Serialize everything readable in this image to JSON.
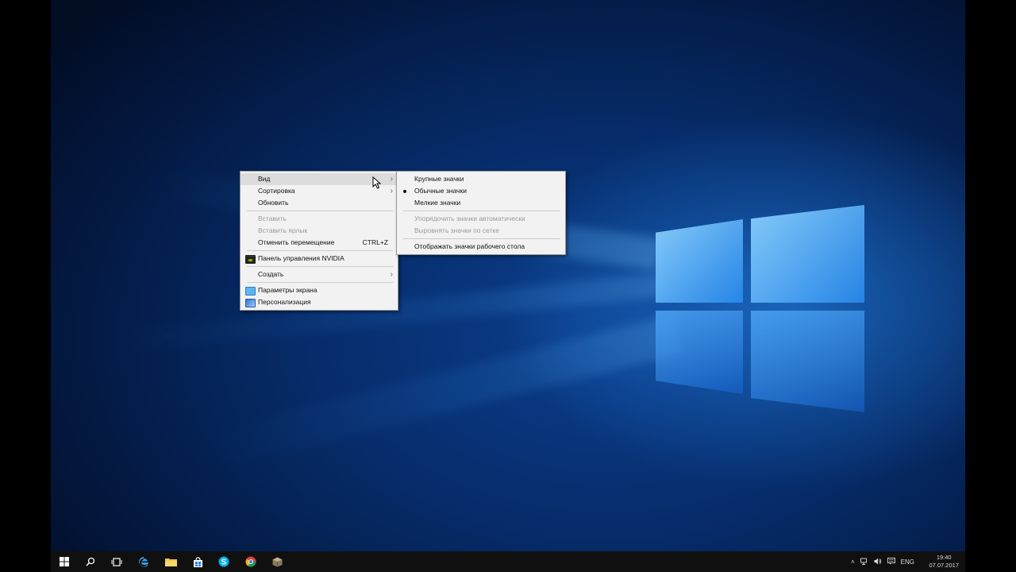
{
  "main_menu": {
    "items": [
      {
        "label": "Вид",
        "submenu": true
      },
      {
        "label": "Сортировка",
        "submenu": true
      },
      {
        "label": "Обновить"
      },
      {
        "label": "Вставить",
        "disabled": true
      },
      {
        "label": "Вставить ярлык",
        "disabled": true
      },
      {
        "label": "Отменить перемещение",
        "shortcut": "CTRL+Z"
      },
      {
        "label": "Панель управления NVIDIA",
        "icon": "nvidia-icon"
      },
      {
        "label": "Создать",
        "submenu": true
      },
      {
        "label": "Параметры экрана",
        "icon": "display-settings-icon"
      },
      {
        "label": "Персонализация",
        "icon": "personalization-icon"
      }
    ]
  },
  "view_submenu": {
    "items": [
      {
        "label": "Крупные значки"
      },
      {
        "label": "Обычные значки",
        "checked": true
      },
      {
        "label": "Мелкие значки"
      },
      {
        "label": "Упорядочить значки автоматически",
        "disabled": true
      },
      {
        "label": "Выровнять значки по сетке",
        "disabled": true
      },
      {
        "label": "Отображать значки рабочего стола"
      }
    ]
  },
  "taskbar": {
    "icons": [
      "windows-start-icon",
      "search-icon",
      "task-view-icon",
      "edge-icon",
      "file-explorer-icon",
      "store-icon",
      "skype-icon",
      "chrome-icon",
      "app-icon"
    ],
    "tray": {
      "language": "ENG",
      "time": "19:40",
      "date": "07.07.2017"
    }
  },
  "colors": {
    "taskbar_bg": "#101010",
    "menu_bg": "#f2f2f2",
    "accent_blue": "#1e7fe0"
  }
}
